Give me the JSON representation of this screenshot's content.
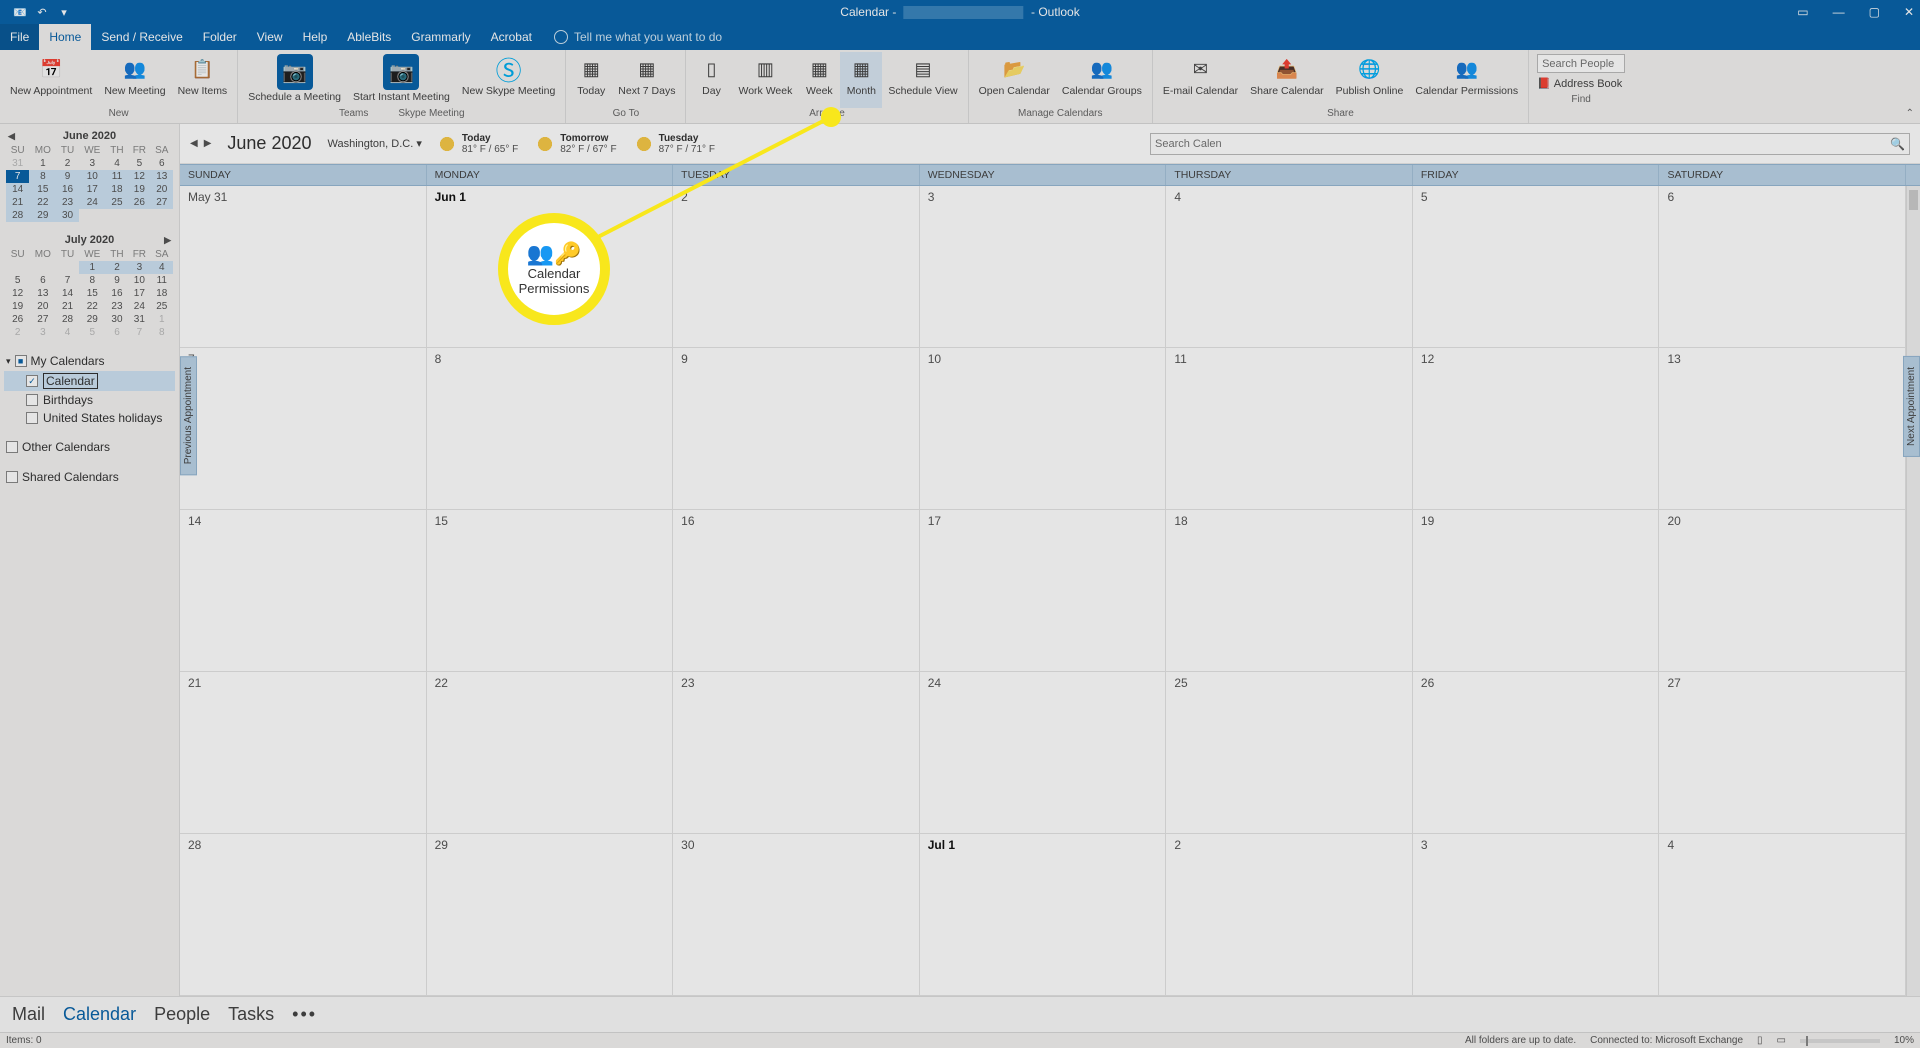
{
  "titlebar": {
    "app": "Calendar -",
    "suffix": "- Outlook"
  },
  "menutabs": [
    "File",
    "Home",
    "Send / Receive",
    "Folder",
    "View",
    "Help",
    "AbleBits",
    "Grammarly",
    "Acrobat"
  ],
  "tellme": "Tell me what you want to do",
  "ribbon": {
    "new": {
      "appointment": "New Appointment",
      "meeting": "New Meeting",
      "items": "New Items",
      "label": "New"
    },
    "skype": {
      "schedule": "Schedule a Meeting",
      "instant": "Start Instant Meeting",
      "newskype": "New Skype Meeting",
      "labelSkype": "Skype Meeting",
      "labelTeams": "Teams"
    },
    "goto": {
      "today": "Today",
      "next7": "Next 7 Days",
      "label": "Go To"
    },
    "arrange": {
      "day": "Day",
      "workweek": "Work Week",
      "week": "Week",
      "month": "Month",
      "schedview": "Schedule View",
      "label": "Arrange"
    },
    "manage": {
      "open": "Open Calendar",
      "groups": "Calendar Groups",
      "label": "Manage Calendars"
    },
    "share": {
      "email": "E-mail Calendar",
      "share": "Share Calendar",
      "publish": "Publish Online",
      "perm": "Calendar Permissions",
      "label": "Share"
    },
    "find": {
      "placeholder": "Search People",
      "ab": "Address Book",
      "label": "Find"
    }
  },
  "sidebar": {
    "month1": {
      "title": "June 2020",
      "dow": [
        "SU",
        "MO",
        "TU",
        "WE",
        "TH",
        "FR",
        "SA"
      ]
    },
    "month2": {
      "title": "July 2020"
    },
    "myCalendars": "My Calendars",
    "calendar": "Calendar",
    "birthdays": "Birthdays",
    "usHolidays": "United States holidays",
    "otherCalendars": "Other Calendars",
    "sharedCalendars": "Shared Calendars"
  },
  "calhdr": {
    "title": "June 2020",
    "location": "Washington, D.C.",
    "weather": [
      {
        "label": "Today",
        "temp": "81° F / 65° F"
      },
      {
        "label": "Tomorrow",
        "temp": "82° F / 67° F"
      },
      {
        "label": "Tuesday",
        "temp": "87° F / 71° F"
      }
    ],
    "search": "Search Calen"
  },
  "grid": {
    "days": [
      "SUNDAY",
      "MONDAY",
      "TUESDAY",
      "WEDNESDAY",
      "THURSDAY",
      "FRIDAY",
      "SATURDAY"
    ],
    "weeks": [
      [
        "May 31",
        "Jun 1",
        "2",
        "3",
        "4",
        "5",
        "6"
      ],
      [
        "7",
        "8",
        "9",
        "10",
        "11",
        "12",
        "13"
      ],
      [
        "14",
        "15",
        "16",
        "17",
        "18",
        "19",
        "20"
      ],
      [
        "21",
        "22",
        "23",
        "24",
        "25",
        "26",
        "27"
      ],
      [
        "28",
        "29",
        "30",
        "Jul 1",
        "2",
        "3",
        "4"
      ]
    ]
  },
  "prevAppt": "Previous Appointment",
  "nextAppt": "Next Appointment",
  "callout": {
    "line1": "Calendar",
    "line2": "Permissions"
  },
  "navbar": [
    "Mail",
    "Calendar",
    "People",
    "Tasks"
  ],
  "status": {
    "items": "Items: 0",
    "folders": "All folders are up to date.",
    "connected": "Connected to: Microsoft Exchange",
    "zoom": "10%"
  },
  "minical1": [
    [
      "31",
      "1",
      "2",
      "3",
      "4",
      "5",
      "6"
    ],
    [
      "7",
      "8",
      "9",
      "10",
      "11",
      "12",
      "13"
    ],
    [
      "14",
      "15",
      "16",
      "17",
      "18",
      "19",
      "20"
    ],
    [
      "21",
      "22",
      "23",
      "24",
      "25",
      "26",
      "27"
    ],
    [
      "28",
      "29",
      "30",
      "",
      "",
      "",
      ""
    ]
  ],
  "minical2": [
    [
      "",
      "",
      "",
      "1",
      "2",
      "3",
      "4"
    ],
    [
      "5",
      "6",
      "7",
      "8",
      "9",
      "10",
      "11"
    ],
    [
      "12",
      "13",
      "14",
      "15",
      "16",
      "17",
      "18"
    ],
    [
      "19",
      "20",
      "21",
      "22",
      "23",
      "24",
      "25"
    ],
    [
      "26",
      "27",
      "28",
      "29",
      "30",
      "31",
      "1"
    ],
    [
      "2",
      "3",
      "4",
      "5",
      "6",
      "7",
      "8"
    ]
  ]
}
